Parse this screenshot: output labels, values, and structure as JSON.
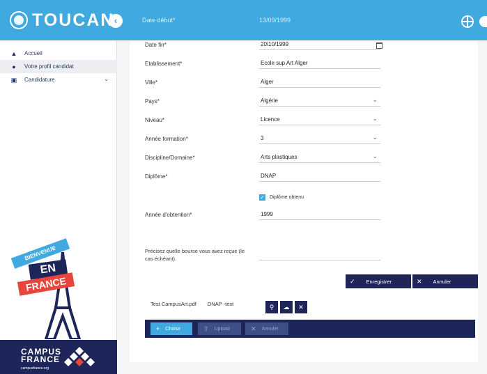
{
  "header": {
    "logo_text": "TOUCAN",
    "faded_label": "Date début*",
    "faded_value": "13/09/1999"
  },
  "sidebar": {
    "items": [
      {
        "label": "Accueil",
        "icon": "home-icon"
      },
      {
        "label": "Votre profil candidat",
        "icon": "user-icon"
      },
      {
        "label": "Candidature",
        "icon": "document-icon"
      }
    ],
    "promo": {
      "line1": "BIENVENUE",
      "line2": "EN",
      "line3": "FRANCE",
      "brand1": "CAMPUS",
      "brand2": "FRANCE",
      "brand_sub": "campusfrance.org"
    }
  },
  "form": {
    "fields": [
      {
        "label": "Date fin*",
        "value": "20/10/1999",
        "kind": "date"
      },
      {
        "label": "Etablissement*",
        "value": "Ecole sup Art Alger",
        "kind": "text"
      },
      {
        "label": "Ville*",
        "value": "Alger",
        "kind": "text"
      },
      {
        "label": "Pays*",
        "value": "Algérie",
        "kind": "select"
      },
      {
        "label": "Niveau*",
        "value": "Licence",
        "kind": "select"
      },
      {
        "label": "Année formation*",
        "value": "3",
        "kind": "select"
      },
      {
        "label": "Discipline/Domaine*",
        "value": "Arts plastiques",
        "kind": "select"
      },
      {
        "label": "Diplôme*",
        "value": "DNAP",
        "kind": "text"
      }
    ],
    "checkbox_label": "Diplôme obtenu",
    "year_label": "Année d'obtention*",
    "year_value": "1999",
    "scholarship_label": "Précisez quelle bourse vous avez reçue (le cas échéant).",
    "scholarship_value": "",
    "save_label": "Enregistrer",
    "cancel_label": "Annuler"
  },
  "attachment": {
    "file_name": "Test CampusArt.pdf",
    "file_type": "DNAP -test",
    "choose_label": "Choisir",
    "upload_label": "Upload",
    "cancel_label": "Annuler"
  },
  "colors": {
    "topbar": "#3fa9e0",
    "navy": "#1e2559",
    "accent_red": "#e8453c"
  }
}
